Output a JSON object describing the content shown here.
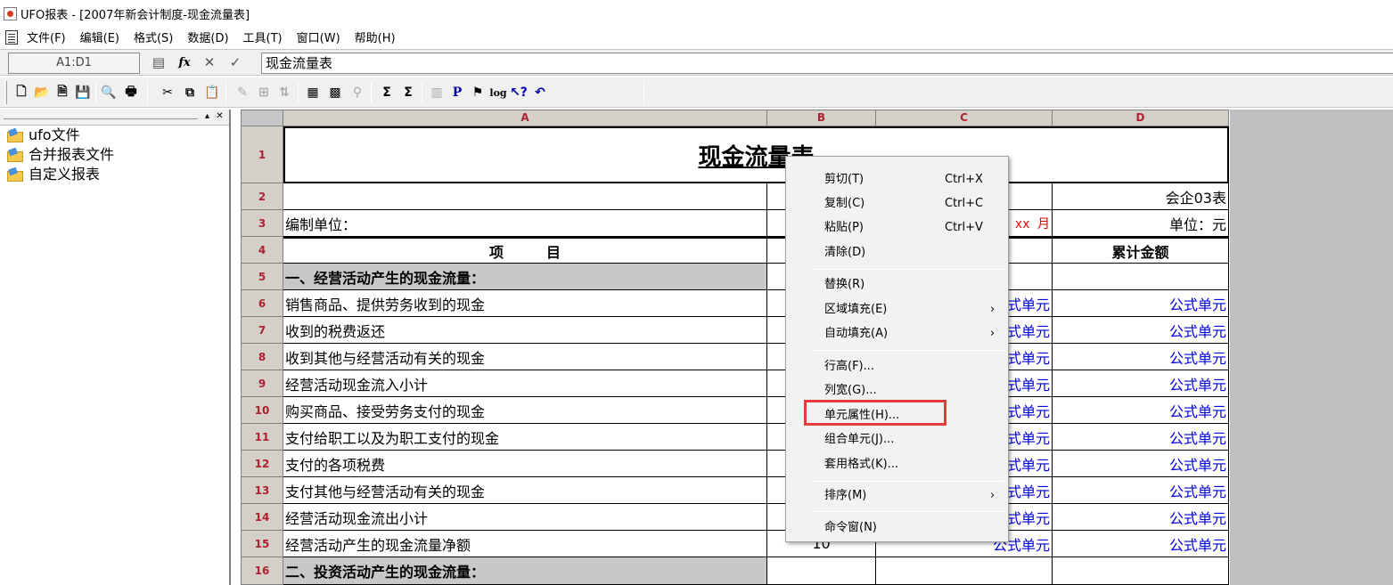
{
  "window": {
    "title": "UFO报表 - [2007年新会计制度-现金流量表]"
  },
  "menubar": {
    "items": [
      "文件(F)",
      "编辑(E)",
      "格式(S)",
      "数据(D)",
      "工具(T)",
      "窗口(W)",
      "帮助(H)"
    ]
  },
  "formula_bar": {
    "cell_ref": "A1:D1",
    "content": "现金流量表"
  },
  "tree": {
    "items": [
      "ufo文件",
      "合并报表文件",
      "自定义报表"
    ]
  },
  "sheet": {
    "columns": [
      "A",
      "B",
      "C",
      "D"
    ],
    "rows": [
      "1",
      "2",
      "3",
      "4",
      "5",
      "6",
      "7",
      "8",
      "9",
      "10",
      "11",
      "12",
      "13",
      "14",
      "15",
      "16"
    ],
    "title": "现金流量表",
    "r2_d": "会企03表",
    "r3_a": "编制单位：",
    "r3_c": "xx 月",
    "r3_d": "单位：元",
    "r4_a": "项　　　目",
    "r4_d": "累计金额",
    "items": [
      "一、经营活动产生的现金流量：",
      "销售商品、提供劳务收到的现金",
      "收到的税费返还",
      "收到其他与经营活动有关的现金",
      "经营活动现金流入小计",
      "购买商品、接受劳务支付的现金",
      "支付给职工以及为职工支付的现金",
      "支付的各项税费",
      "支付其他与经营活动有关的现金",
      "经营活动现金流出小计",
      "经营活动产生的现金流量净额",
      "二、投资活动产生的现金流量："
    ],
    "formula_cell_c": "式单元",
    "formula_cell_c_row15": "公式单元",
    "formula_cell_d": "公式单元",
    "r15_b": "10"
  },
  "context_menu": {
    "items": {
      "cut": {
        "label": "剪切(T)",
        "shortcut": "Ctrl+X"
      },
      "copy": {
        "label": "复制(C)",
        "shortcut": "Ctrl+C"
      },
      "paste": {
        "label": "粘贴(P)",
        "shortcut": "Ctrl+V"
      },
      "clear": {
        "label": "清除(D)"
      },
      "replace": {
        "label": "替换(R)"
      },
      "area_fill": {
        "label": "区域填充(E)"
      },
      "auto_fill": {
        "label": "自动填充(A)"
      },
      "row_height": {
        "label": "行高(F)..."
      },
      "col_width": {
        "label": "列宽(G)..."
      },
      "cell_props": {
        "label": "单元属性(H)..."
      },
      "merge_cells": {
        "label": "组合单元(J)..."
      },
      "apply_format": {
        "label": "套用格式(K)..."
      },
      "sort": {
        "label": "排序(M)"
      },
      "command_window": {
        "label": "命令窗(N)"
      }
    },
    "submenu_arrow": "›",
    "highlight_color": "#e83a3a"
  }
}
